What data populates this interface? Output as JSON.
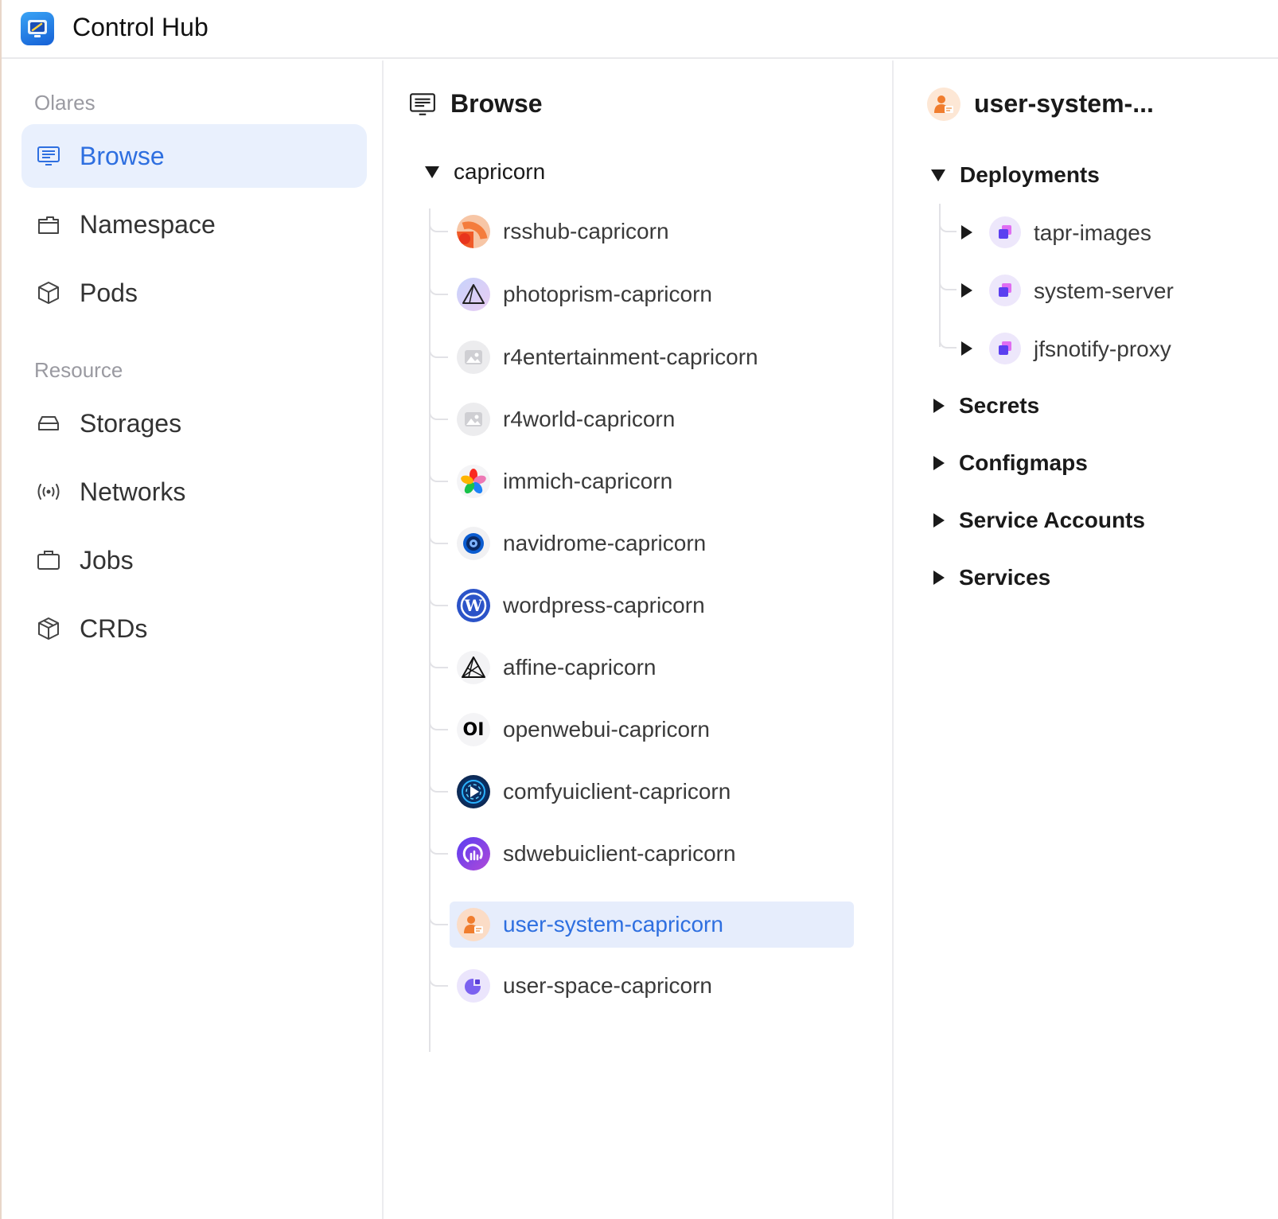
{
  "app": {
    "title": "Control Hub"
  },
  "sidebar": {
    "sections": [
      {
        "label": "Olares"
      },
      {
        "label": "Resource"
      }
    ],
    "items": [
      {
        "label": "Browse",
        "icon": "monitor-list-icon",
        "active": true
      },
      {
        "label": "Namespace",
        "icon": "folder-icon"
      },
      {
        "label": "Pods",
        "icon": "cube-icon"
      },
      {
        "label": "Storages",
        "icon": "drive-icon"
      },
      {
        "label": "Networks",
        "icon": "broadcast-icon"
      },
      {
        "label": "Jobs",
        "icon": "briefcase-icon"
      },
      {
        "label": "CRDs",
        "icon": "cube-icon"
      }
    ],
    "accent": "#2e6fe0",
    "active_bg": "#e9f0fd"
  },
  "browse": {
    "title": "Browse",
    "root": "capricorn",
    "namespaces": [
      {
        "label": "rsshub-capricorn",
        "icon": "rsshub-icon"
      },
      {
        "label": "photoprism-capricorn",
        "icon": "photoprism-icon"
      },
      {
        "label": "r4entertainment-capricorn",
        "icon": "image-placeholder-icon"
      },
      {
        "label": "r4world-capricorn",
        "icon": "image-placeholder-icon"
      },
      {
        "label": "immich-capricorn",
        "icon": "immich-icon"
      },
      {
        "label": "navidrome-capricorn",
        "icon": "navidrome-icon"
      },
      {
        "label": "wordpress-capricorn",
        "icon": "wordpress-icon"
      },
      {
        "label": "affine-capricorn",
        "icon": "affine-icon"
      },
      {
        "label": "openwebui-capricorn",
        "icon": "openwebui-icon",
        "icon_text": "OI"
      },
      {
        "label": "comfyuiclient-capricorn",
        "icon": "comfyui-icon"
      },
      {
        "label": "sdwebuiclient-capricorn",
        "icon": "sdwebui-icon"
      },
      {
        "label": "user-system-capricorn",
        "icon": "user-system-icon",
        "active": true
      },
      {
        "label": "user-space-capricorn",
        "icon": "user-space-icon"
      }
    ]
  },
  "detail": {
    "title": "user-system-...",
    "groups": [
      {
        "label": "Deployments",
        "expanded": true,
        "items": [
          {
            "label": "tapr-images"
          },
          {
            "label": "system-server"
          },
          {
            "label": "jfsnotify-proxy"
          }
        ]
      },
      {
        "label": "Secrets",
        "expanded": false
      },
      {
        "label": "Configmaps",
        "expanded": false
      },
      {
        "label": "Service Accounts",
        "expanded": false
      },
      {
        "label": "Services",
        "expanded": false
      }
    ]
  }
}
